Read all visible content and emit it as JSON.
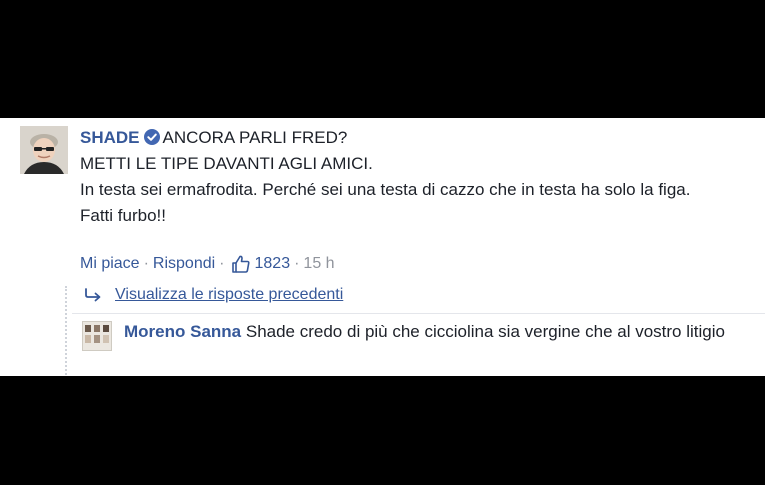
{
  "comment": {
    "author": "SHADE",
    "lines": [
      "ANCORA PARLI FRED?",
      "METTI LE TIPE DAVANTI AGLI AMICI.",
      "In testa sei ermafrodita. Perché sei una testa di cazzo che in testa ha solo la figa.",
      "Fatti furbo!!"
    ],
    "actions": {
      "like": "Mi piace",
      "separator": "·",
      "reply": "Rispondi",
      "like_count": "1823",
      "time": "15 h"
    }
  },
  "replies": {
    "view_previous": "Visualizza le risposte precedenti",
    "items": [
      {
        "author": "Moreno Sanna",
        "text": "Shade credo di più che cicciolina sia vergine che al vostro litigio"
      }
    ]
  },
  "colors": {
    "link": "#365899",
    "text": "#1d2129",
    "muted": "#90949c",
    "verified": "#4267b2"
  },
  "icons": {
    "verified": "verified-badge-icon",
    "like": "thumbs-up-icon",
    "reply_arrow": "reply-arrow-icon"
  }
}
